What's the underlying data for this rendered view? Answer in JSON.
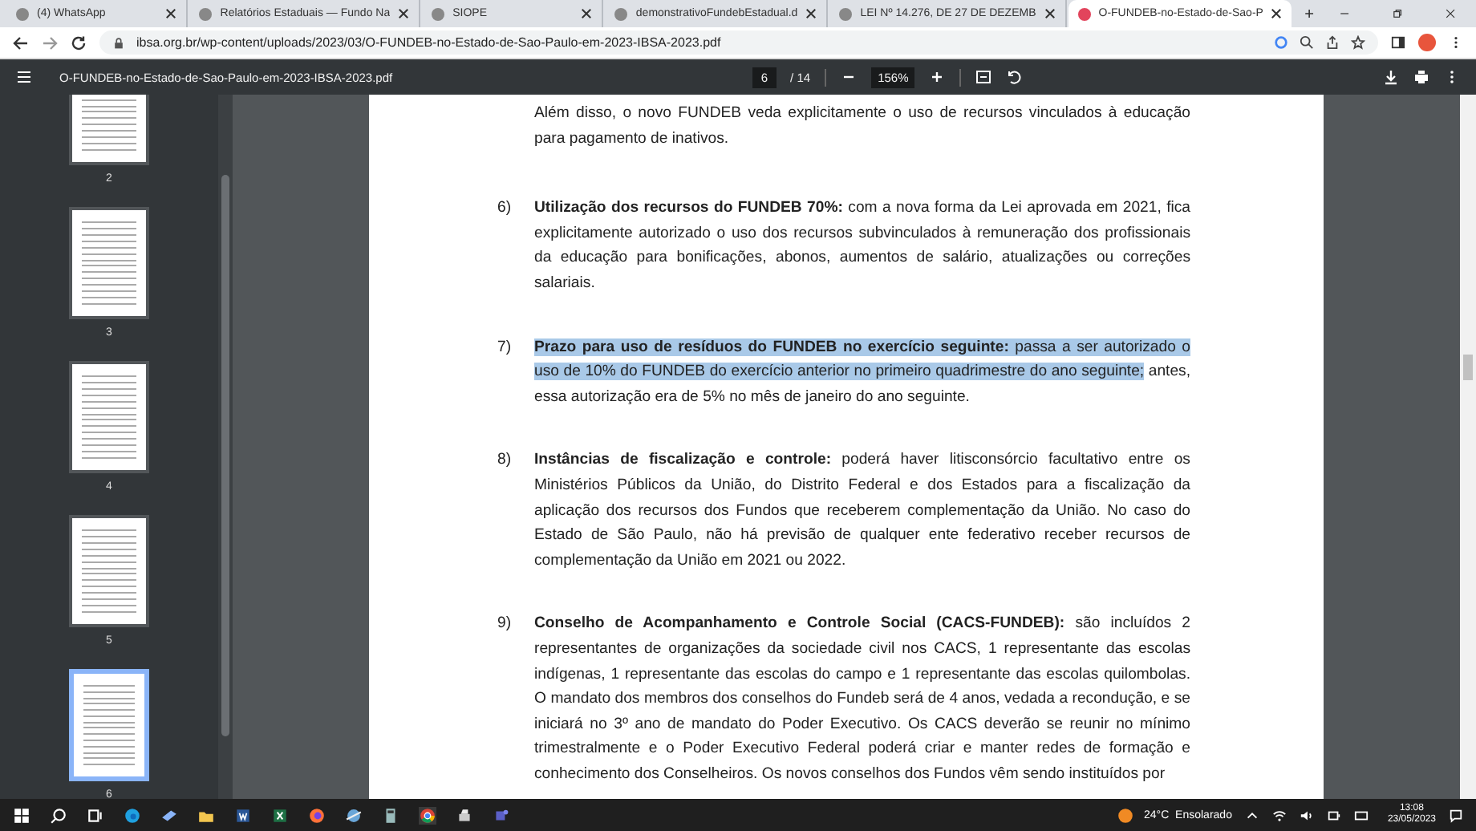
{
  "browser_tabs": [
    {
      "title": "(4) WhatsApp",
      "selected": false
    },
    {
      "title": "Relatórios Estaduais — Fundo Na",
      "selected": false
    },
    {
      "title": "SIOPE",
      "selected": false
    },
    {
      "title": "demonstrativoFundebEstadual.d",
      "selected": false
    },
    {
      "title": "LEI Nº 14.276, DE 27 DE DEZEMB",
      "selected": false
    },
    {
      "title": "O-FUNDEB-no-Estado-de-Sao-P",
      "selected": true
    }
  ],
  "address_bar": {
    "url": "ibsa.org.br/wp-content/uploads/2023/03/O-FUNDEB-no-Estado-de-Sao-Paulo-em-2023-IBSA-2023.pdf"
  },
  "pdf_toolbar": {
    "file_name": "O-FUNDEB-no-Estado-de-Sao-Paulo-em-2023-IBSA-2023.pdf",
    "page": "6",
    "page_total": "/ 14",
    "zoom": "156%"
  },
  "thumbnails": [
    {
      "label": "2",
      "selected": false
    },
    {
      "label": "3",
      "selected": false
    },
    {
      "label": "4",
      "selected": false
    },
    {
      "label": "5",
      "selected": false
    },
    {
      "label": "6",
      "selected": true
    }
  ],
  "document": {
    "intro": "Além disso, o novo FUNDEB veda explicitamente o uso de recursos vinculados à educação para pagamento de inativos.",
    "items": [
      {
        "number": "6)",
        "segments": [
          {
            "text": "Utilização dos recursos do FUNDEB 70%:",
            "bold": true,
            "highlighted": false
          },
          {
            "text": " com a nova forma da Lei aprovada em 2021, fica explicitamente autorizado o uso dos recursos subvinculados à remuneração dos profissionais da educação para bonificações, abonos, aumentos de salário, atualizações ou correções salariais.",
            "bold": false,
            "highlighted": false
          }
        ]
      },
      {
        "number": "7)",
        "segments": [
          {
            "text": "Prazo para uso de resíduos do FUNDEB no exercício seguinte:",
            "bold": true,
            "highlighted": true
          },
          {
            "text": " passa a ser autorizado o uso de 10% do FUNDEB do exercício anterior no primeiro quadrimestre do ano seguinte;",
            "bold": false,
            "highlighted": true
          },
          {
            "text": " antes, essa autorização era de 5% no mês de janeiro do ano seguinte.",
            "bold": false,
            "highlighted": false
          }
        ]
      },
      {
        "number": "8)",
        "segments": [
          {
            "text": "Instâncias de fiscalização e controle:",
            "bold": true,
            "highlighted": false
          },
          {
            "text": " poderá haver litisconsórcio facultativo entre os Ministérios Públicos da União, do Distrito Federal e dos Estados para a fiscalização da aplicação dos recursos dos Fundos que receberem complementação da União. No caso do Estado de São Paulo, não há previsão de qualquer ente federativo receber recursos de complementação da União em 2021 ou 2022.",
            "bold": false,
            "highlighted": false
          }
        ]
      },
      {
        "number": "9)",
        "segments": [
          {
            "text": "Conselho de Acompanhamento e Controle Social (CACS-FUNDEB):",
            "bold": true,
            "highlighted": false
          },
          {
            "text": " são incluídos 2 representantes de organizações da sociedade civil nos CACS, 1 representante das escolas indígenas, 1 representante das escolas do campo e 1 representante das escolas quilombolas. O mandato dos membros dos conselhos do Fundeb será de 4 anos, vedada a recondução, e se iniciará no 3º ano de mandato do Poder Executivo. Os CACS deverão se reunir no mínimo trimestralmente e o Poder Executivo Federal poderá criar e manter redes de formação e conhecimento dos Conselheiros. Os novos conselhos dos Fundos vêm sendo instituídos por",
            "bold": false,
            "highlighted": false
          }
        ]
      }
    ]
  },
  "taskbar": {
    "weather": "24°C  Ensolarado",
    "time": "13:08",
    "date": "23/05/2023"
  }
}
